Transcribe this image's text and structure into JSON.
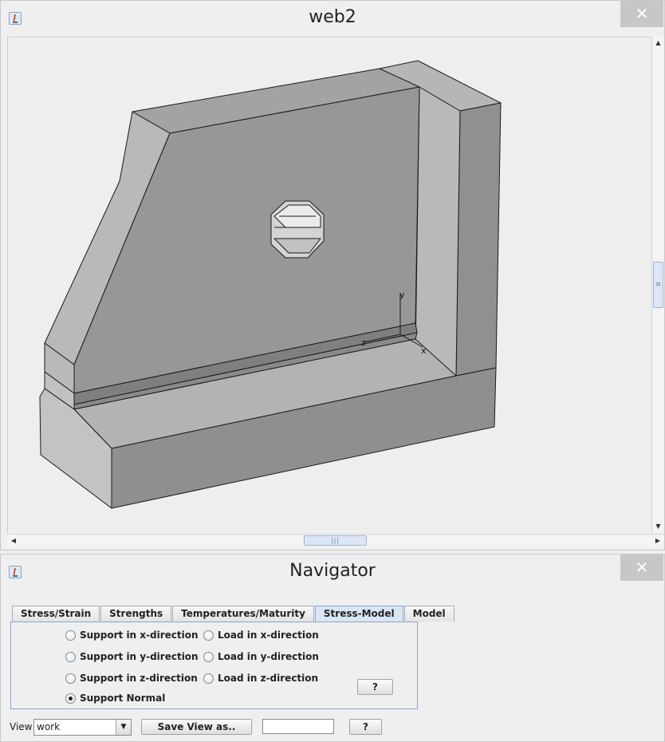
{
  "model_window": {
    "title": "web2",
    "close_glyph": "✕",
    "axis_labels": {
      "y": "y",
      "z": "z",
      "x": "x"
    }
  },
  "navigator": {
    "title": "Navigator",
    "close_glyph": "✕",
    "tabs": [
      {
        "label": "Stress/Strain",
        "active": false
      },
      {
        "label": "Strengths",
        "active": false
      },
      {
        "label": "Temperatures/Maturity",
        "active": false
      },
      {
        "label": "Stress-Model",
        "active": true
      },
      {
        "label": "Model",
        "active": false
      }
    ],
    "stress_model": {
      "support_x": {
        "label": "Support in x-direction",
        "checked": false
      },
      "support_y": {
        "label": "Support in y-direction",
        "checked": false
      },
      "support_z": {
        "label": "Support in z-direction",
        "checked": false
      },
      "support_normal": {
        "label": "Support Normal",
        "checked": true
      },
      "load_x": {
        "label": "Load in x-direction",
        "checked": false
      },
      "load_y": {
        "label": "Load in y-direction",
        "checked": false
      },
      "load_z": {
        "label": "Load in z-direction",
        "checked": false
      },
      "help_label": "?"
    },
    "footer": {
      "view_label": "View",
      "view_value": "work",
      "save_label": "Save View as..",
      "name_value": "",
      "help_label": "?"
    }
  },
  "icons": {
    "window_icon": "java-cup-icon",
    "close": "close-icon",
    "dropdown": "chevron-down-icon"
  },
  "colors": {
    "tab_active": "#d9e6f5",
    "panel_border": "#8fa7c6",
    "scroll_thumb": "#dbe7f6",
    "close_button": "#c7c7c7"
  }
}
